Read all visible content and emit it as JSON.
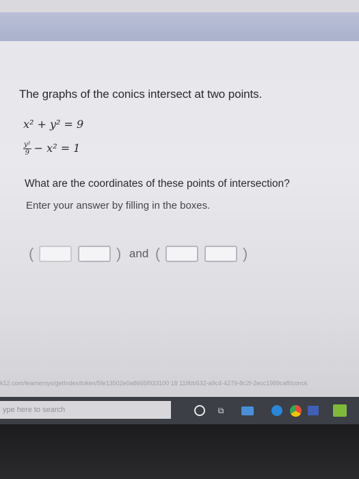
{
  "problem": {
    "intro": "The graphs of the conics intersect at two points.",
    "eq1": "x² + y² = 9",
    "eq2": {
      "frac_num": "y²",
      "frac_den": "9",
      "rest": "− x² = 1"
    },
    "question": "What are the coordinates of these points of intersection?",
    "instructions": "Enter your answer by filling in the boxes.",
    "answer": {
      "open_paren": "(",
      "close_paren": ")",
      "and_label": "and",
      "point1": {
        "x": "",
        "y": ""
      },
      "point2": {
        "x": "",
        "y": ""
      }
    }
  },
  "browser": {
    "url_fragment": "k12.com/learnersys/getIndex/token/5fe13502e0a8665f933100 18 119bb532-a9c4-4279-8c2f-2ecc1989caff/conck"
  },
  "taskbar": {
    "search_placeholder": "ype here to search",
    "icons": [
      "cortana-icon",
      "task-view-icon",
      "mail-icon",
      "edge-icon",
      "chrome-icon",
      "photos-icon",
      "store-icon"
    ]
  }
}
